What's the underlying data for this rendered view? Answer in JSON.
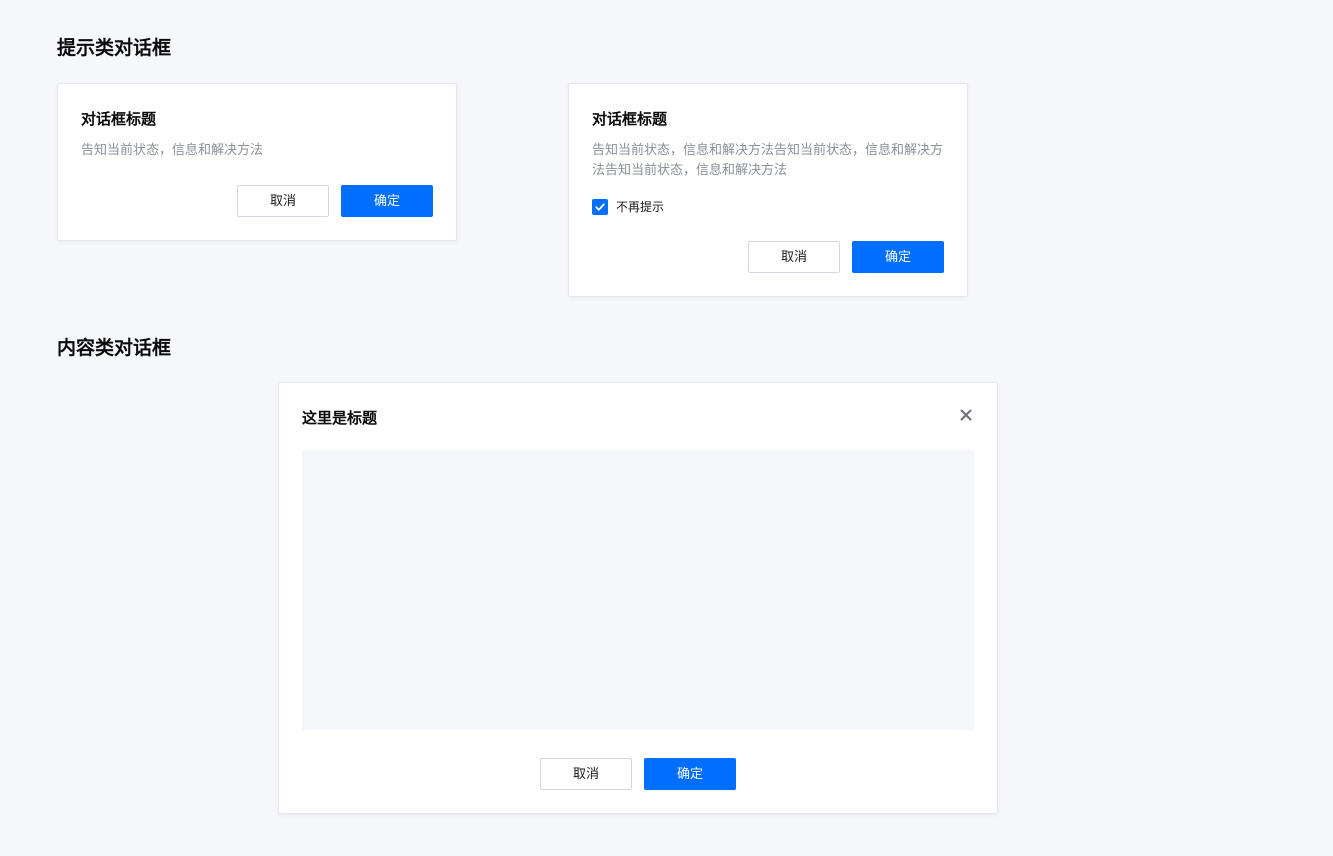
{
  "sections": {
    "tip_title": "提示类对话框",
    "content_title": "内容类对话框"
  },
  "tip_dialog_1": {
    "title": "对话框标题",
    "message": "告知当前状态，信息和解决方法",
    "cancel_label": "取消",
    "ok_label": "确定"
  },
  "tip_dialog_2": {
    "title": "对话框标题",
    "message": "告知当前状态，信息和解决方法告知当前状态，信息和解决方法告知当前状态，信息和解决方法",
    "checkbox_label": "不再提示",
    "checkbox_checked": true,
    "cancel_label": "取消",
    "ok_label": "确定"
  },
  "content_dialog": {
    "title": "这里是标题",
    "close_icon": "close-icon",
    "cancel_label": "取消",
    "ok_label": "确定"
  },
  "colors": {
    "page_background": "#f6f7fb",
    "primary": "#006eff",
    "secondary_text": "#8a8f99",
    "content_placeholder": "#f5f6f9"
  }
}
